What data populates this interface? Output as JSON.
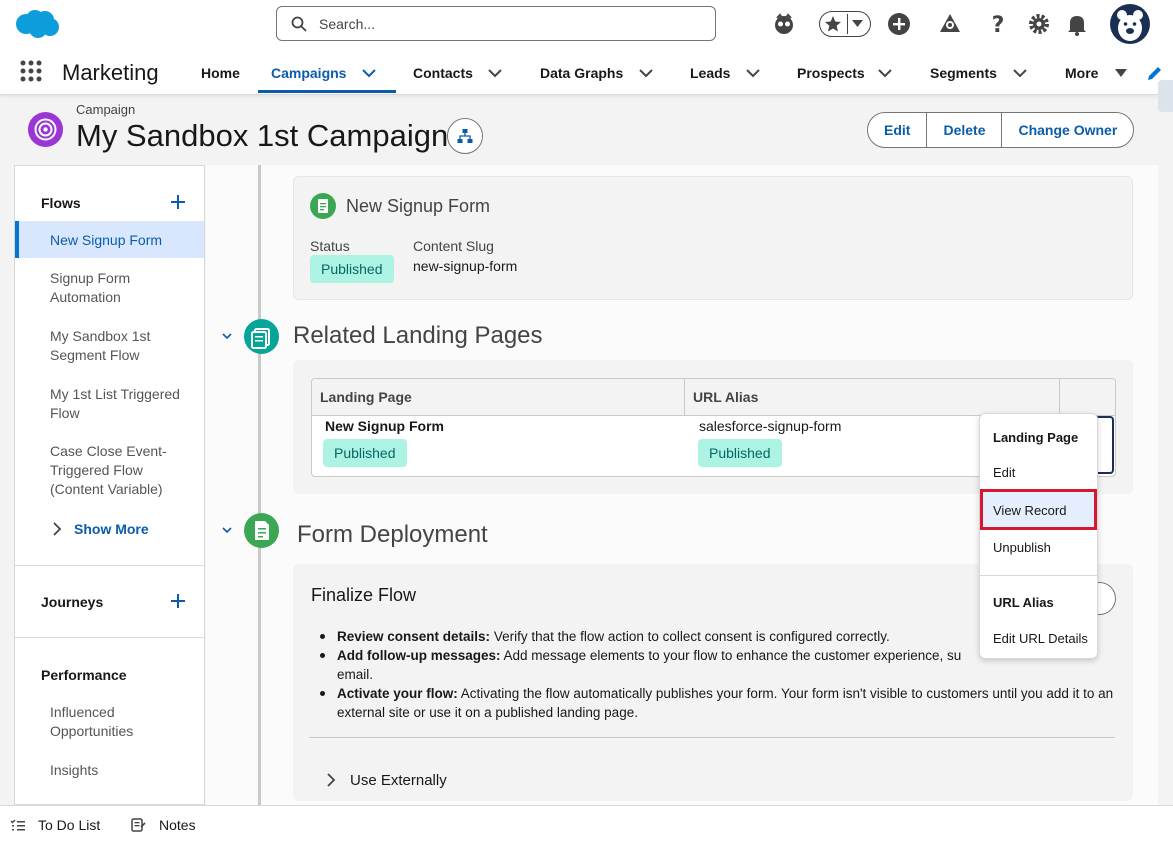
{
  "header": {
    "search_placeholder": "Search...",
    "icons": [
      "salesforce-logo",
      "search-icon",
      "agent-icon",
      "favorites-star-icon",
      "favorites-dropdown-icon",
      "global-create-icon",
      "trailhead-icon",
      "help-icon",
      "setup-gear-icon",
      "notifications-bell-icon",
      "user-avatar"
    ]
  },
  "nav": {
    "app_name": "Marketing",
    "items": [
      {
        "label": "Home",
        "dropdown": false
      },
      {
        "label": "Campaigns",
        "dropdown": true,
        "active": true
      },
      {
        "label": "Contacts",
        "dropdown": true
      },
      {
        "label": "Data Graphs",
        "dropdown": true
      },
      {
        "label": "Leads",
        "dropdown": true
      },
      {
        "label": "Prospects",
        "dropdown": true
      },
      {
        "label": "Segments",
        "dropdown": true
      },
      {
        "label": "More",
        "dropdown": true
      }
    ],
    "accent_color": "#0b5cab"
  },
  "record": {
    "type": "Campaign",
    "title": "My Sandbox 1st Campaign",
    "buttons": [
      "Edit",
      "Delete",
      "Change Owner"
    ]
  },
  "left_panel": {
    "flows_heading": "Flows",
    "flows": [
      {
        "label": "New Signup Form",
        "selected": true
      },
      {
        "label": "Signup Form Automation"
      },
      {
        "label": "My Sandbox 1st Segment Flow"
      },
      {
        "label": "My 1st List Triggered Flow"
      },
      {
        "label": "Case Close Event-Triggered Flow (Content Variable)"
      }
    ],
    "show_more": "Show More",
    "journeys_heading": "Journeys",
    "performance_heading": "Performance",
    "performance_items": [
      "Influenced Opportunities",
      "Insights"
    ]
  },
  "flow_card": {
    "name": "New Signup Form",
    "status_label": "Status",
    "status_value": "Published",
    "slug_label": "Content Slug",
    "slug_value": "new-signup-form"
  },
  "landing_pages": {
    "title": "Related Landing Pages",
    "columns": [
      "Landing Page",
      "URL Alias"
    ],
    "rows": [
      {
        "landing_page": "New Signup Form",
        "landing_status": "Published",
        "url_alias": "salesforce-signup-form",
        "url_status": "Published"
      }
    ]
  },
  "row_menu": {
    "header1": "Landing Page",
    "item_edit": "Edit",
    "item_view": "View Record",
    "item_unpublish": "Unpublish",
    "header2": "URL Alias",
    "item_edit_url": "Edit URL Details"
  },
  "form_deployment": {
    "title": "Form Deployment",
    "card_title": "Finalize Flow",
    "bullets": [
      {
        "bold": "Review consent details:",
        "text": " Verify that the flow action to collect consent is configured correctly."
      },
      {
        "bold": "Add follow-up messages:",
        "text": " Add message elements to your flow to enhance the customer experience, su                                          email."
      },
      {
        "bold": "Activate your flow:",
        "text": " Activating the flow automatically publishes your form. Your form isn't visible to customers until you add it to an external site or use it on a published landing page."
      }
    ],
    "use_externally": "Use Externally"
  },
  "footer": {
    "todo": "To Do List",
    "notes": "Notes"
  }
}
